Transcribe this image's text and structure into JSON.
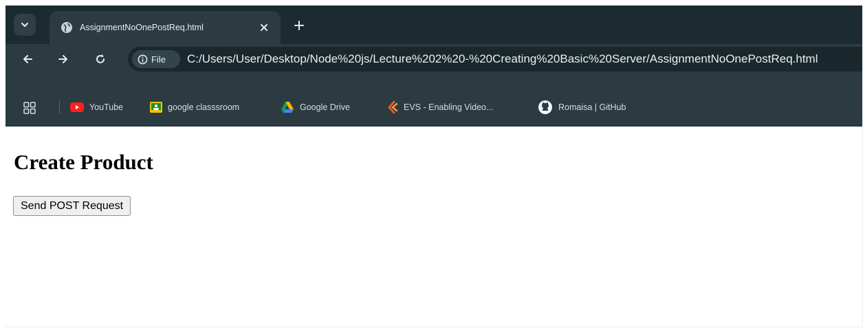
{
  "browser": {
    "tab": {
      "title": "AssignmentNoOnePostReq.html"
    },
    "toolbar": {
      "site_chip_label": "File",
      "url": "C:/Users/User/Desktop/Node%20js/Lecture%202%20-%20Creating%20Basic%20Server/AssignmentNoOnePostReq.html"
    },
    "bookmarks": [
      {
        "label": "YouTube",
        "icon": "youtube-icon"
      },
      {
        "label": "google classsroom",
        "icon": "classroom-icon"
      },
      {
        "label": "Google Drive",
        "icon": "drive-icon"
      },
      {
        "label": "EVS - Enabling Video...",
        "icon": "evs-icon"
      },
      {
        "label": "Romaisa | GitHub",
        "icon": "github-icon"
      }
    ]
  },
  "page": {
    "title": "Create Product",
    "button_label": "Send POST Request"
  },
  "colors": {
    "tabstrip": "#1b2b31",
    "toolbar": "#2b3b41",
    "omnibox": "#1a282d",
    "page_background": "#ffffff"
  }
}
